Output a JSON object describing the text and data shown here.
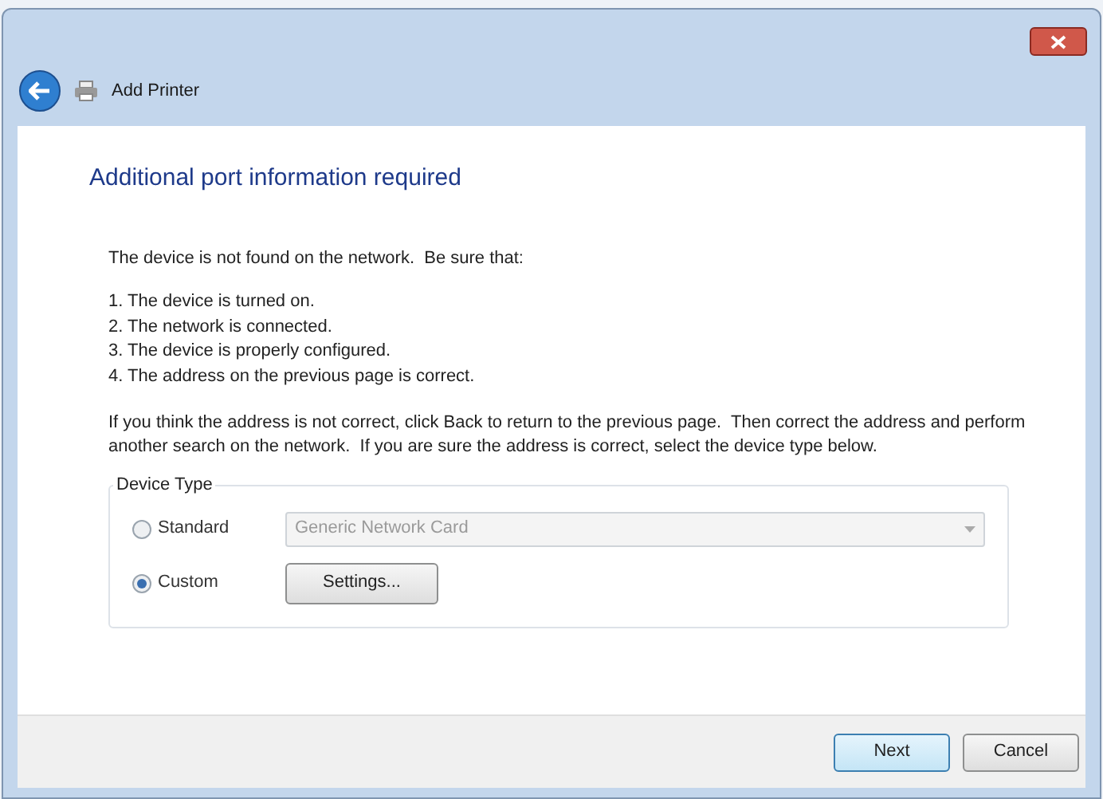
{
  "window": {
    "title": "Add Printer"
  },
  "heading": "Additional port information required",
  "intro": "The device is not found on the network.  Be sure that:",
  "checklist": [
    {
      "number": "1.",
      "text": "The device is turned on."
    },
    {
      "number": "2.",
      "text": "The network is connected."
    },
    {
      "number": "3.",
      "text": "The device is properly configured."
    },
    {
      "number": "4.",
      "text": "The address on the previous page is correct."
    }
  ],
  "instructions": "If you think the address is not correct, click Back to return to the previous page.  Then correct the address and perform another search on the network.  If you are sure the address is correct, select the device type below.",
  "device_type": {
    "legend": "Device Type",
    "options": [
      {
        "label": "Standard",
        "selected": false,
        "kind": "dropdown",
        "value": "Generic Network Card",
        "disabled": true
      },
      {
        "label": "Custom",
        "selected": true,
        "kind": "button",
        "button": "Settings..."
      }
    ]
  },
  "buttons": [
    {
      "label": "Next",
      "default": true
    },
    {
      "label": "Cancel",
      "default": false
    }
  ]
}
